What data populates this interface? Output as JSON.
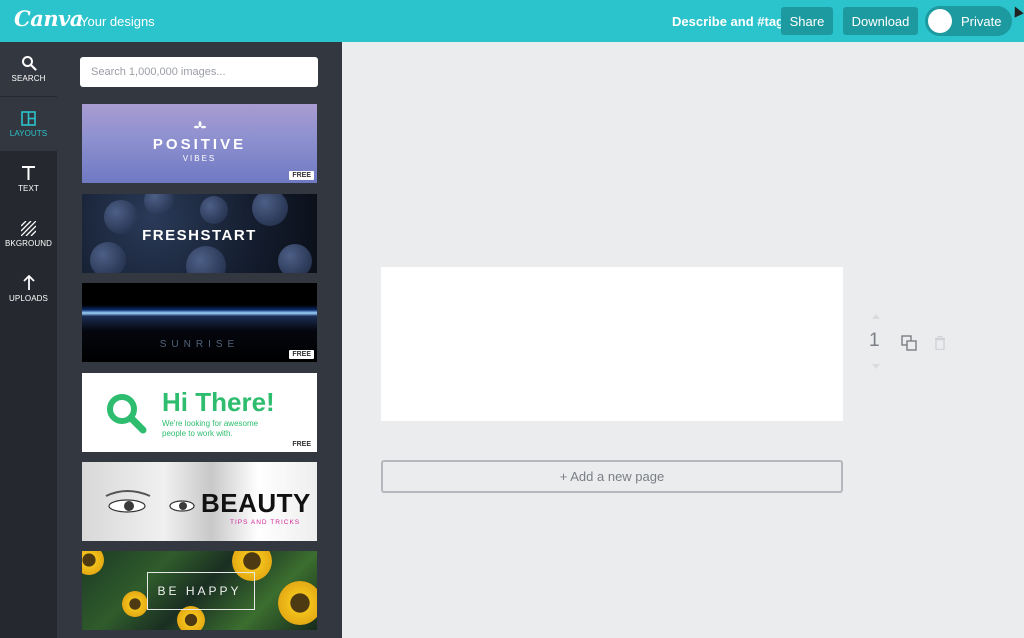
{
  "topbar": {
    "logo": "Canva",
    "your_designs": "Your designs",
    "describe": "Describe and #tag",
    "share_label": "Share",
    "download_label": "Download",
    "privacy_label": "Private",
    "accent_color": "#2bc3cc"
  },
  "nav": {
    "items": [
      {
        "label": "SEARCH",
        "icon": "search-icon"
      },
      {
        "label": "LAYOUTS",
        "icon": "layouts-icon"
      },
      {
        "label": "TEXT",
        "icon": "text-icon"
      },
      {
        "label": "BKGROUND",
        "icon": "background-icon"
      },
      {
        "label": "UPLOADS",
        "icon": "upload-icon"
      }
    ],
    "selected": "LAYOUTS"
  },
  "panel": {
    "search_placeholder": "Search 1,000,000 images...",
    "layouts": [
      {
        "title": "POSITIVE",
        "subtitle": "VIBES",
        "badge": "FREE"
      },
      {
        "title": "FRESHSTART"
      },
      {
        "title": "SUNRISE",
        "badge": "FREE"
      },
      {
        "title": "Hi There!",
        "subtitle": "We're looking for awesome people to work with.",
        "badge": "FREE"
      },
      {
        "title": "BEAUTY",
        "subtitle": "TIPS AND TRICKS"
      },
      {
        "title": "BE HAPPY"
      }
    ]
  },
  "editor": {
    "page_number": "1",
    "add_page_label": "+ Add a new page"
  }
}
